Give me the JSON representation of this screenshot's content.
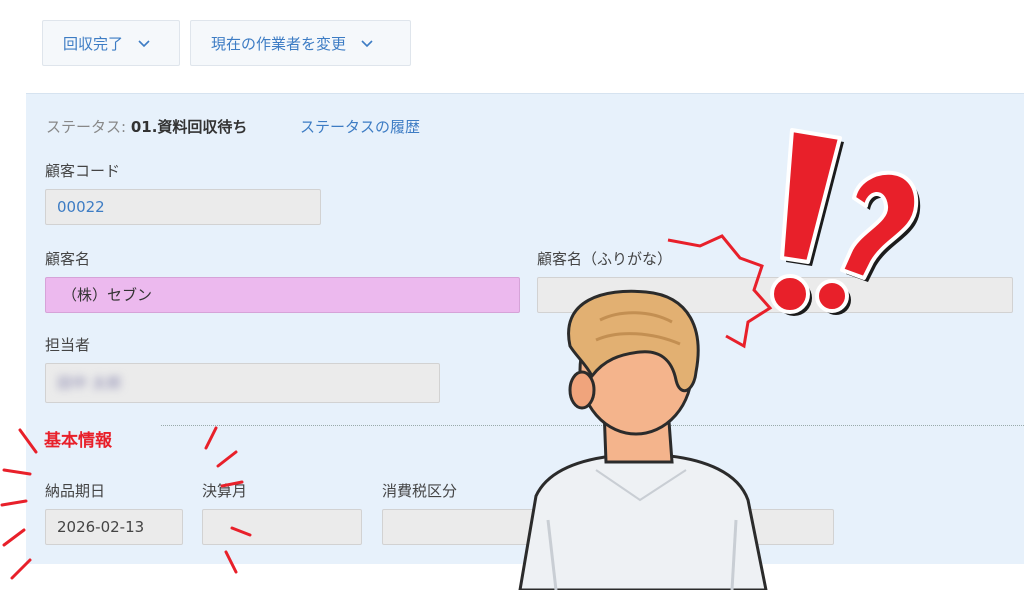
{
  "toolbar": {
    "complete_label": "回収完了",
    "change_worker_label": "現在の作業者を変更"
  },
  "status": {
    "label": "ステータス:",
    "value": "01.資料回収待ち",
    "history_link": "ステータスの履歴"
  },
  "fields": {
    "customer_code": {
      "label": "顧客コード",
      "value": "00022"
    },
    "customer_name": {
      "label": "顧客名",
      "value": "（株）セブン"
    },
    "customer_name_kana": {
      "label": "顧客名（ふりがな）",
      "value": ""
    },
    "person_in_charge": {
      "label": "担当者",
      "value": "田中 太郎"
    }
  },
  "basic_info": {
    "title": "基本情報",
    "delivery_date": {
      "label": "納品期日",
      "value": "2026-02-13"
    },
    "fiscal_month": {
      "label": "決算月",
      "value": ""
    },
    "tax_category": {
      "label": "消費税区分",
      "value": ""
    }
  },
  "icons": [
    "chevron-down-icon",
    "exclamation-icon",
    "question-icon"
  ],
  "colors": {
    "accent_blue": "#3d7cc4",
    "panel_bg": "#e7f1fb",
    "highlight_pink": "#ecb9ee",
    "section_red": "#e8202a"
  }
}
